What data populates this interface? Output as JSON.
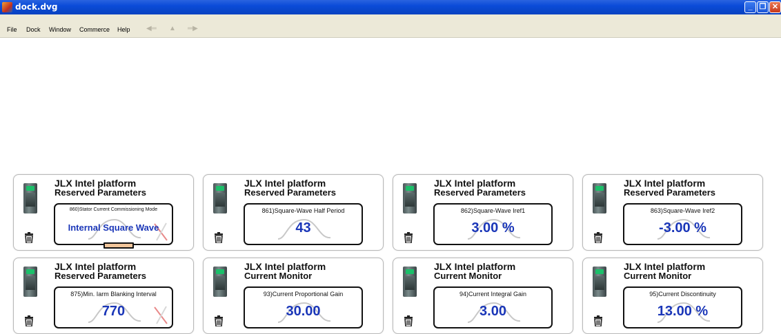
{
  "window": {
    "title": "dock.dvg",
    "controls": {
      "minimize": "_",
      "restore": "❐",
      "close": "✕"
    }
  },
  "menu": {
    "items": [
      "File",
      "Dock",
      "Window",
      "Commerce",
      "Help"
    ],
    "nav": [
      "back-arrow-icon",
      "up-arrow-icon",
      "forward-arrow-icon"
    ]
  },
  "panels": [
    {
      "title": "JLX Intel platform",
      "subtitle": "Reserved Parameters",
      "label": "860)Stator Current Commissioning Mode",
      "value": "Internal Square Wave",
      "value_type": "text",
      "crossed": true,
      "slider": true
    },
    {
      "title": "JLX Intel platform",
      "subtitle": "Reserved Parameters",
      "label": "861)Square-Wave Half Period",
      "value": "43",
      "crossed": false
    },
    {
      "title": "JLX Intel platform",
      "subtitle": "Reserved Parameters",
      "label": "862)Square-Wave Iref1",
      "value": "3.00 %",
      "crossed": false
    },
    {
      "title": "JLX Intel platform",
      "subtitle": "Reserved Parameters",
      "label": "863)Square-Wave Iref2",
      "value": "-3.00 %",
      "crossed": false
    },
    {
      "title": "JLX Intel platform",
      "subtitle": "Reserved Parameters",
      "label": "875)Min. Iarm Blanking Interval",
      "value": "770",
      "crossed": true
    },
    {
      "title": "JLX Intel platform",
      "subtitle": "Current Monitor",
      "label": "93)Current Proportional Gain",
      "value": "30.00",
      "crossed": false
    },
    {
      "title": "JLX Intel platform",
      "subtitle": "Current Monitor",
      "label": "94)Current Integral Gain",
      "value": "3.00",
      "crossed": false
    },
    {
      "title": "JLX Intel platform",
      "subtitle": "Current Monitor",
      "label": "95)Current Discontinuity",
      "value": "13.00 %",
      "crossed": false
    }
  ],
  "colors": {
    "value": "#1a36b8",
    "titlebar": "#0a4bd8",
    "menubar": "#ece9d8"
  }
}
